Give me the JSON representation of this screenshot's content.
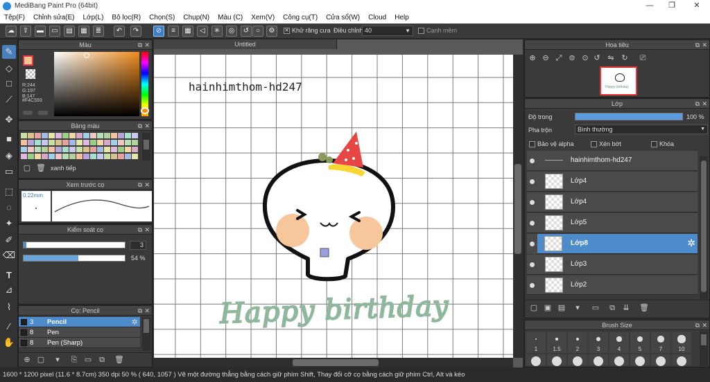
{
  "window": {
    "title": "MediBang Paint Pro (64bit)",
    "minimize": "—",
    "restore": "❐",
    "close": "✕"
  },
  "menu": [
    "Tệp(F)",
    "Chỉnh sửa(E)",
    "Lớp(L)",
    "Bộ lọc(R)",
    "Chọn(S)",
    "Chụp(N)",
    "Màu (C)",
    "Xem(V)",
    "Công cụ(T)",
    "Cửa sổ(W)",
    "Cloud",
    "Help"
  ],
  "toolbar": {
    "antialias_label": "Khử răng cưa",
    "adjust_label": "Điều chỉnh",
    "adjust_value": "40",
    "edge_label": "Cạnh mềm",
    "antialias_checked": "✕"
  },
  "color_panel": {
    "title": "Màu",
    "r": "R:244",
    "g": "G:197",
    "b": "B:147",
    "hex": "#F4C593",
    "main_color": "#F4C593"
  },
  "palette_panel": {
    "title": "Bảng màu",
    "label": "xanh tiếp"
  },
  "brush_preview": {
    "title": "Xem trước cọ",
    "size": "0.22mm"
  },
  "brush_control": {
    "title": "Kiểm soát cọ",
    "size_value": "3",
    "opacity_value": "54 %",
    "opacity": 0.54,
    "size_fill": 0.03
  },
  "brush_panel": {
    "title": "Cọ: Pencil",
    "items": [
      {
        "num": "3",
        "name": "Pencil",
        "selected": true
      },
      {
        "num": "8",
        "name": "Pen",
        "selected": false
      },
      {
        "num": "8",
        "name": "Pen (Sharp)",
        "selected": false
      }
    ]
  },
  "canvas": {
    "tab": "Untitled",
    "overlay_text": "hainhimthom-hd247",
    "handwriting": "Happy birthday"
  },
  "navigator": {
    "title": "Hoa tiêu",
    "thumb_text": "Happy birthday"
  },
  "layer_panel": {
    "title": "Lớp",
    "opacity_label": "Độ trong",
    "opacity_value": "100 %",
    "opacity": 1.0,
    "blend_label": "Pha trộn",
    "blend_value": "Bình thường",
    "protect_alpha": "Bảo vệ alpha",
    "clipping": "Xén bớt",
    "lock": "Khóa",
    "layers": [
      {
        "name": "hainhimthom-hd247",
        "selected": false
      },
      {
        "name": "Lớp4",
        "selected": false
      },
      {
        "name": "Lớp4",
        "selected": false
      },
      {
        "name": "Lớp5",
        "selected": false
      },
      {
        "name": "Lớp8",
        "selected": true
      },
      {
        "name": "Lớp3",
        "selected": false
      },
      {
        "name": "Lớp2",
        "selected": false
      }
    ]
  },
  "brush_size_panel": {
    "title": "Brush Size",
    "sizes": [
      "1",
      "1.5",
      "2",
      "3",
      "4",
      "5",
      "7",
      "10"
    ]
  },
  "status": {
    "text": "1600 * 1200 pixel   (11.6 * 8.7cm)   350 dpi   50 %   ( 640, 1057 )   Vẽ một đường thẳng bằng cách giữ phím Shift, Thay đổi cỡ cọ bằng cách giữ phím Ctrl, Alt và kéo"
  }
}
